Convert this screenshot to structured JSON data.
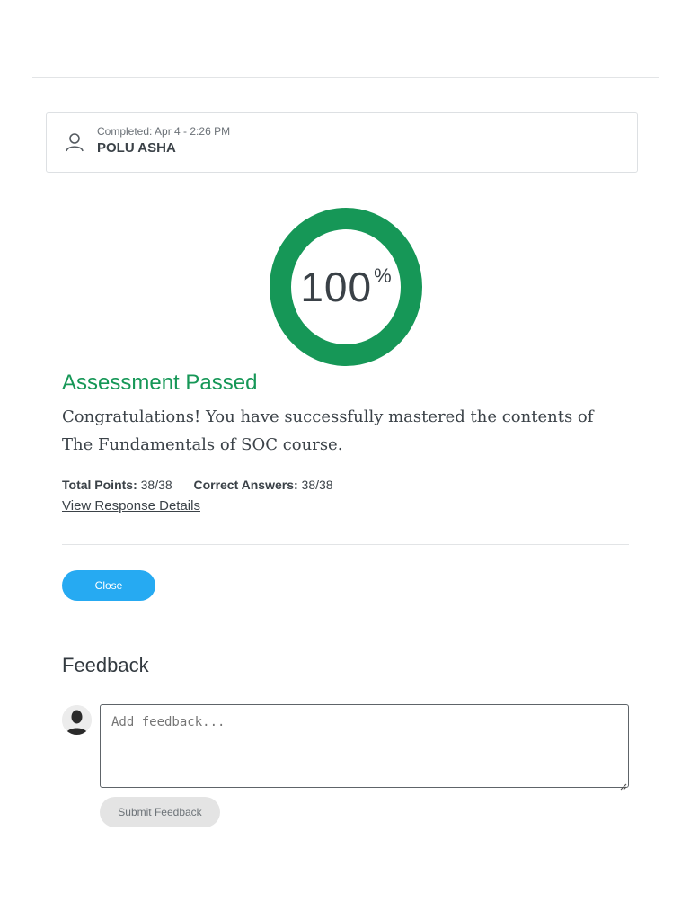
{
  "user_card": {
    "completed_label": "Completed: Apr 4 - 2:26 PM",
    "user_name": "POLU ASHA",
    "icon": "person-icon"
  },
  "score": {
    "value": "100",
    "unit": "%",
    "ring_color": "#169757",
    "progress": 1.0
  },
  "result": {
    "title": "Assessment Passed",
    "message": "Congratulations! You have successfully mastered the contents of The Fundamentals of SOC course.",
    "title_color": "#169757"
  },
  "stats": {
    "total_points_label": "Total Points:",
    "total_points_value": "38/38",
    "correct_answers_label": "Correct Answers:",
    "correct_answers_value": "38/38"
  },
  "links": {
    "view_response_details": "View Response Details"
  },
  "buttons": {
    "close_label": "Close",
    "close_color": "#26aaf2",
    "submit_feedback_label": "Submit Feedback"
  },
  "feedback": {
    "title": "Feedback",
    "placeholder": "Add feedback...",
    "value": "",
    "avatar_icon": "user-silhouette-icon"
  }
}
